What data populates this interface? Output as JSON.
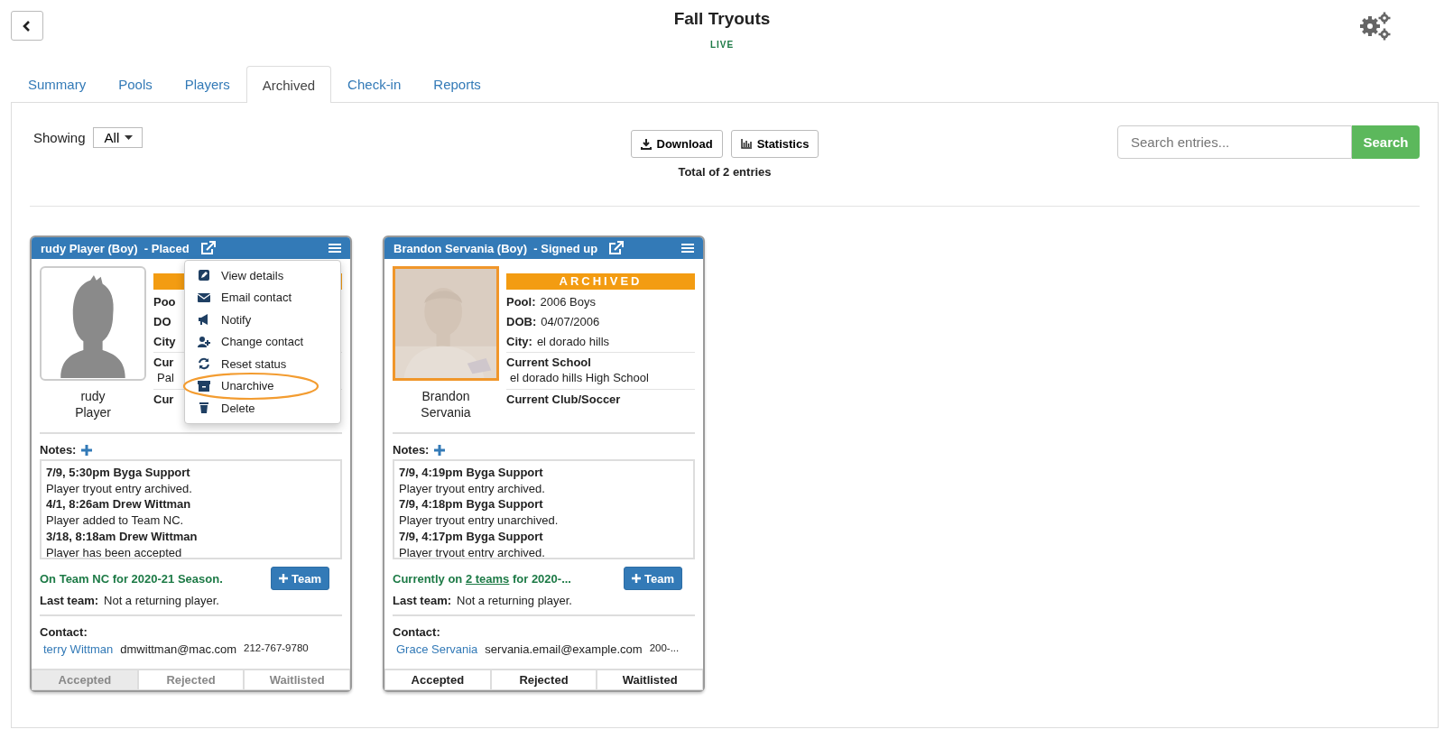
{
  "title": "Fall Tryouts",
  "status_label": "LIVE",
  "tabs": [
    {
      "label": "Summary",
      "selected": false
    },
    {
      "label": "Pools",
      "selected": false
    },
    {
      "label": "Players",
      "selected": false
    },
    {
      "label": "Archived",
      "selected": true
    },
    {
      "label": "Check-in",
      "selected": false
    },
    {
      "label": "Reports",
      "selected": false
    }
  ],
  "showing": {
    "label": "Showing",
    "value": "All"
  },
  "toolbar": {
    "buttons": [
      "Download",
      "Statistics"
    ],
    "total": "Total of 2 entries"
  },
  "search": {
    "placeholder": "Search entries...",
    "button": "Search"
  },
  "cards": [
    {
      "header": "rudy Player (Boy)  - Placed",
      "photo": {
        "kind": "silhouette"
      },
      "name_lines": [
        "rudy",
        "Player"
      ],
      "archived": true,
      "facts": [
        {
          "label": "Poo"
        },
        {
          "label": "DO"
        },
        {
          "label": "City"
        }
      ],
      "sections": [
        {
          "label": "Cur",
          "value": "Pal"
        },
        {
          "label": "Cur"
        }
      ],
      "notes_label": "Notes:",
      "notes": [
        {
          "head": "7/9, 5:30pm  Byga Support",
          "body": "Player tryout entry archived."
        },
        {
          "head": "4/1, 8:26am  Drew Wittman",
          "body": "Player added to Team NC."
        },
        {
          "head": "3/18, 8:18am  Drew Wittman",
          "body": "Player has been accepted"
        }
      ],
      "team_status": {
        "text": "On Team NC for 2020-21 Season."
      },
      "team_button": "Team",
      "last_team": {
        "label": "Last team:",
        "value": "Not a returning player."
      },
      "contact": {
        "label": "Contact:",
        "name": "terry Wittman",
        "email": "dmwittman@mac.com",
        "phone": "212-767-9780"
      },
      "statuses": [
        {
          "label": "Accepted",
          "selected": true,
          "disabled": true
        },
        {
          "label": "Rejected",
          "selected": false,
          "disabled": true
        },
        {
          "label": "Waitlisted",
          "selected": false,
          "disabled": true
        }
      ],
      "menu": {
        "items": [
          {
            "label": "View details",
            "highlighted": false
          },
          {
            "label": "Email contact",
            "highlighted": false
          },
          {
            "label": "Notify",
            "highlighted": false
          },
          {
            "label": "Change contact",
            "highlighted": false
          },
          {
            "label": "Reset status",
            "highlighted": false
          },
          {
            "label": "Unarchive",
            "highlighted": true
          },
          {
            "label": "Delete",
            "highlighted": false
          }
        ]
      }
    },
    {
      "header": "Brandon Servania (Boy)  - Signed up",
      "photo": {
        "kind": "picture"
      },
      "name_lines": [
        "Brandon",
        "Servania"
      ],
      "archived": true,
      "banner": "ARCHIVED",
      "facts": [
        {
          "label": "Pool:",
          "value": "2006 Boys"
        },
        {
          "label": "DOB:",
          "value": "04/07/2006"
        },
        {
          "label": "City:",
          "value": "el dorado hills"
        }
      ],
      "sections": [
        {
          "label": "Current School",
          "value": "el dorado hills High School"
        },
        {
          "label": "Current Club/Soccer"
        }
      ],
      "notes_label": "Notes:",
      "notes": [
        {
          "head": "7/9, 4:19pm  Byga Support",
          "body": "Player tryout entry archived."
        },
        {
          "head": "7/9, 4:18pm  Byga Support",
          "body": "Player tryout entry unarchived."
        },
        {
          "head": "7/9, 4:17pm  Byga Support",
          "body": "Player tryout entry archived."
        }
      ],
      "team_status": {
        "before": "Currently on",
        "link": "2 teams",
        "after": "for 2020-..."
      },
      "team_button": "Team",
      "last_team": {
        "label": "Last team:",
        "value": "Not a returning player."
      },
      "contact": {
        "label": "Contact:",
        "name": "Grace Servania",
        "email": "servania.email@example.com",
        "phone": "200-..."
      },
      "statuses": [
        {
          "label": "Accepted",
          "selected": false,
          "disabled": false
        },
        {
          "label": "Rejected",
          "selected": false,
          "disabled": false
        },
        {
          "label": "Waitlisted",
          "selected": false,
          "disabled": false
        }
      ]
    }
  ]
}
